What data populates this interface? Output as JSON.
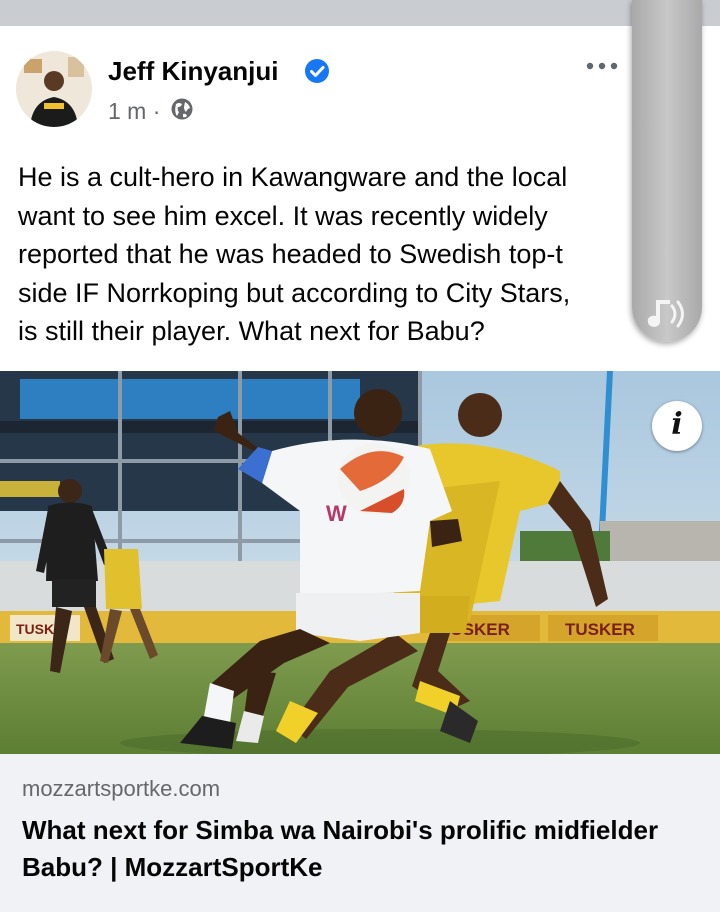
{
  "post": {
    "author": "Jeff Kinyanjui",
    "time": "1 m ·",
    "text": "He is a cult-hero in Kawangware and the local\nwant to see him excel. It was recently widely\nreported that he was headed to Swedish top-t\nside IF Norrkoping but according to City Stars,\nis still their player. What next for Babu?"
  },
  "icons": {
    "verified": "verified-badge-icon",
    "privacy": "globe-icon",
    "more": "more-options-icon",
    "sound": "sound-icon",
    "info": "info-icon"
  },
  "photo": {
    "hoarding_1": "TUSKER",
    "hoarding_2": "TUSKER",
    "hoarding_3": "TUSKE",
    "info_glyph": "i"
  },
  "link": {
    "domain": "mozzartsportke.com",
    "title": "What next for Simba wa Nairobi's prolific midfielder\nBabu? | MozzartSportKe"
  },
  "colors": {
    "verified_blue": "#1877f2",
    "meta_gray": "#65676b",
    "link_bg": "#f0f2f5",
    "away_kit_yellow": "#e8c72c"
  }
}
